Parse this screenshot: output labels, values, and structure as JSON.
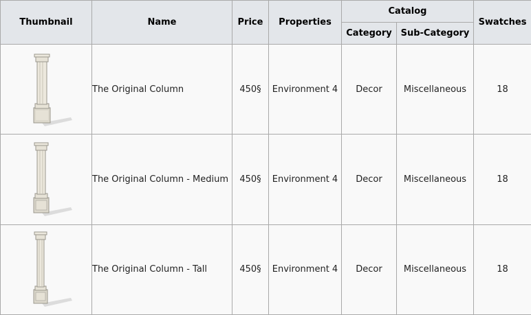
{
  "headers": {
    "thumbnail": "Thumbnail",
    "name": "Name",
    "price": "Price",
    "properties": "Properties",
    "catalog": "Catalog",
    "category": "Category",
    "sub_category": "Sub-Category",
    "swatches": "Swatches"
  },
  "rows": [
    {
      "name": "The Original Column",
      "price": "450§",
      "properties": "Environment 4",
      "category": "Decor",
      "sub_category": "Miscellaneous",
      "swatches": "18",
      "thumbnail_icon": "column-short-icon"
    },
    {
      "name": "The Original Column - Medium",
      "price": "450§",
      "properties": "Environment 4",
      "category": "Decor",
      "sub_category": "Miscellaneous",
      "swatches": "18",
      "thumbnail_icon": "column-medium-icon"
    },
    {
      "name": "The Original Column - Tall",
      "price": "450§",
      "properties": "Environment 4",
      "category": "Decor",
      "sub_category": "Miscellaneous",
      "swatches": "18",
      "thumbnail_icon": "column-tall-icon"
    }
  ],
  "colors": {
    "header_bg": "#e3e6ea",
    "cell_bg": "#f9f9f9",
    "border": "#a9a9a9",
    "column_stone": "#e6e2d6"
  }
}
